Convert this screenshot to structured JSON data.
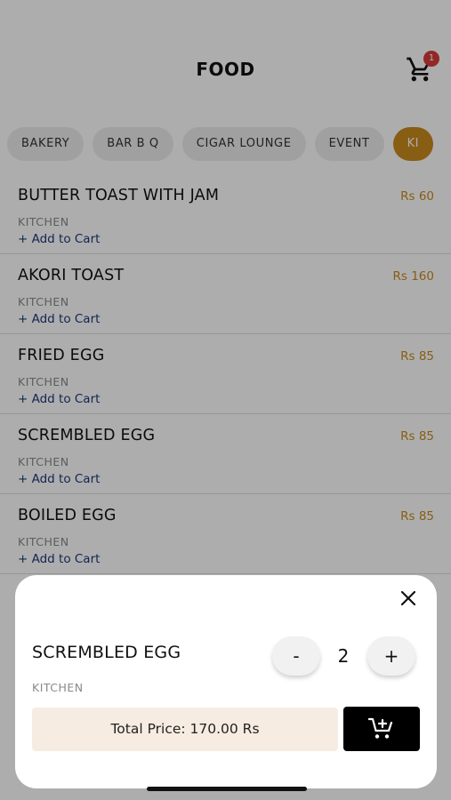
{
  "header": {
    "title": "FOOD",
    "cart_badge": "1"
  },
  "categories": [
    {
      "label": "BAKERY"
    },
    {
      "label": "BAR B Q"
    },
    {
      "label": "CIGAR LOUNGE"
    },
    {
      "label": "EVENT"
    },
    {
      "label": "KI"
    }
  ],
  "items": [
    {
      "name": "BUTTER TOAST WITH JAM",
      "price": "Rs 60",
      "category": "KITCHEN",
      "add_label": "+ Add to Cart"
    },
    {
      "name": "AKORI TOAST",
      "price": "Rs 160",
      "category": "KITCHEN",
      "add_label": "+ Add to Cart"
    },
    {
      "name": "FRIED EGG",
      "price": "Rs 85",
      "category": "KITCHEN",
      "add_label": "+ Add to Cart"
    },
    {
      "name": "SCREMBLED EGG",
      "price": "Rs 85",
      "category": "KITCHEN",
      "add_label": "+ Add to Cart"
    },
    {
      "name": "BOILED EGG",
      "price": "Rs 85",
      "category": "KITCHEN",
      "add_label": "+ Add to Cart"
    }
  ],
  "sheet": {
    "name": "SCREMBLED EGG",
    "category": "KITCHEN",
    "minus_label": "-",
    "quantity": "2",
    "plus_label": "+",
    "total_label": "Total Price: 170.00 Rs"
  },
  "colors": {
    "accent": "#c98a1e",
    "link": "#1c3a78",
    "badge": "#d93a3a",
    "total_bg": "#f7ece1"
  },
  "icons": {
    "cart": "shopping-cart-icon",
    "close": "close-icon",
    "add_to_cart": "add-shopping-cart-icon"
  }
}
